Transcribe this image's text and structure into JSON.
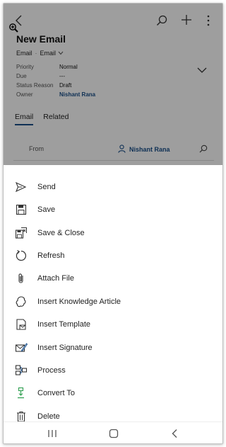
{
  "record": {
    "title": "New Email",
    "entity": "Email",
    "form": "Email",
    "fields": [
      {
        "label": "Priority",
        "value": "Normal"
      },
      {
        "label": "Due",
        "value": "---"
      },
      {
        "label": "Status Reason",
        "value": "Draft"
      },
      {
        "label": "Owner",
        "value": "Nishant Rana"
      }
    ]
  },
  "tabs": [
    {
      "label": "Email",
      "active": true
    },
    {
      "label": "Related",
      "active": false
    }
  ],
  "from": {
    "label": "From",
    "value": "Nishant Rana"
  },
  "menu": {
    "items": [
      {
        "label": "Send",
        "icon": "send-icon"
      },
      {
        "label": "Save",
        "icon": "save-icon"
      },
      {
        "label": "Save & Close",
        "icon": "save-close-icon"
      },
      {
        "label": "Refresh",
        "icon": "refresh-icon"
      },
      {
        "label": "Attach File",
        "icon": "paperclip-icon"
      },
      {
        "label": "Insert Knowledge Article",
        "icon": "knowledge-article-icon"
      },
      {
        "label": "Insert Template",
        "icon": "template-icon"
      },
      {
        "label": "Insert Signature",
        "icon": "signature-icon"
      },
      {
        "label": "Process",
        "icon": "process-icon"
      },
      {
        "label": "Convert To",
        "icon": "convert-icon"
      },
      {
        "label": "Delete",
        "icon": "trash-icon"
      }
    ]
  },
  "colors": {
    "accent": "#1a4f8a",
    "convert_icon": "#2e9e4f",
    "overlay": "#7a7a7a"
  }
}
